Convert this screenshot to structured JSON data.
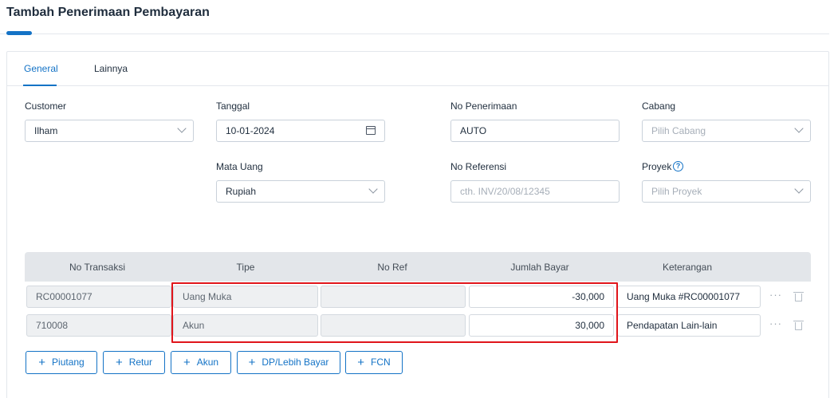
{
  "page": {
    "title": "Tambah Penerimaan Pembayaran"
  },
  "tabs": [
    {
      "label": "General"
    },
    {
      "label": "Lainnya"
    }
  ],
  "form": {
    "customer": {
      "label": "Customer",
      "value": "Ilham"
    },
    "tanggal": {
      "label": "Tanggal",
      "value": "10-01-2024"
    },
    "no_penerimaan": {
      "label": "No Penerimaan",
      "value": "AUTO"
    },
    "cabang": {
      "label": "Cabang",
      "placeholder": "Pilih Cabang"
    },
    "mata_uang": {
      "label": "Mata Uang",
      "value": "Rupiah"
    },
    "no_referensi": {
      "label": "No Referensi",
      "placeholder": "cth. INV/20/08/12345"
    },
    "proyek": {
      "label": "Proyek",
      "placeholder": "Pilih Proyek",
      "help": "?"
    }
  },
  "table": {
    "headers": [
      "No Transaksi",
      "Tipe",
      "No Ref",
      "Jumlah Bayar",
      "Keterangan"
    ],
    "rows": [
      {
        "no_transaksi": "RC00001077",
        "tipe": "Uang Muka",
        "no_ref": "",
        "jumlah": "-30,000",
        "keterangan": "Uang Muka #RC00001077"
      },
      {
        "no_transaksi": "710008",
        "tipe": "Akun",
        "no_ref": "",
        "jumlah": "30,000",
        "keterangan": "Pendapatan Lain-lain"
      }
    ]
  },
  "buttons": [
    "Piutang",
    "Retur",
    "Akun",
    "DP/Lebih Bayar",
    "FCN"
  ],
  "colors": {
    "accent": "#1473c6",
    "highlight": "#e0151b"
  }
}
